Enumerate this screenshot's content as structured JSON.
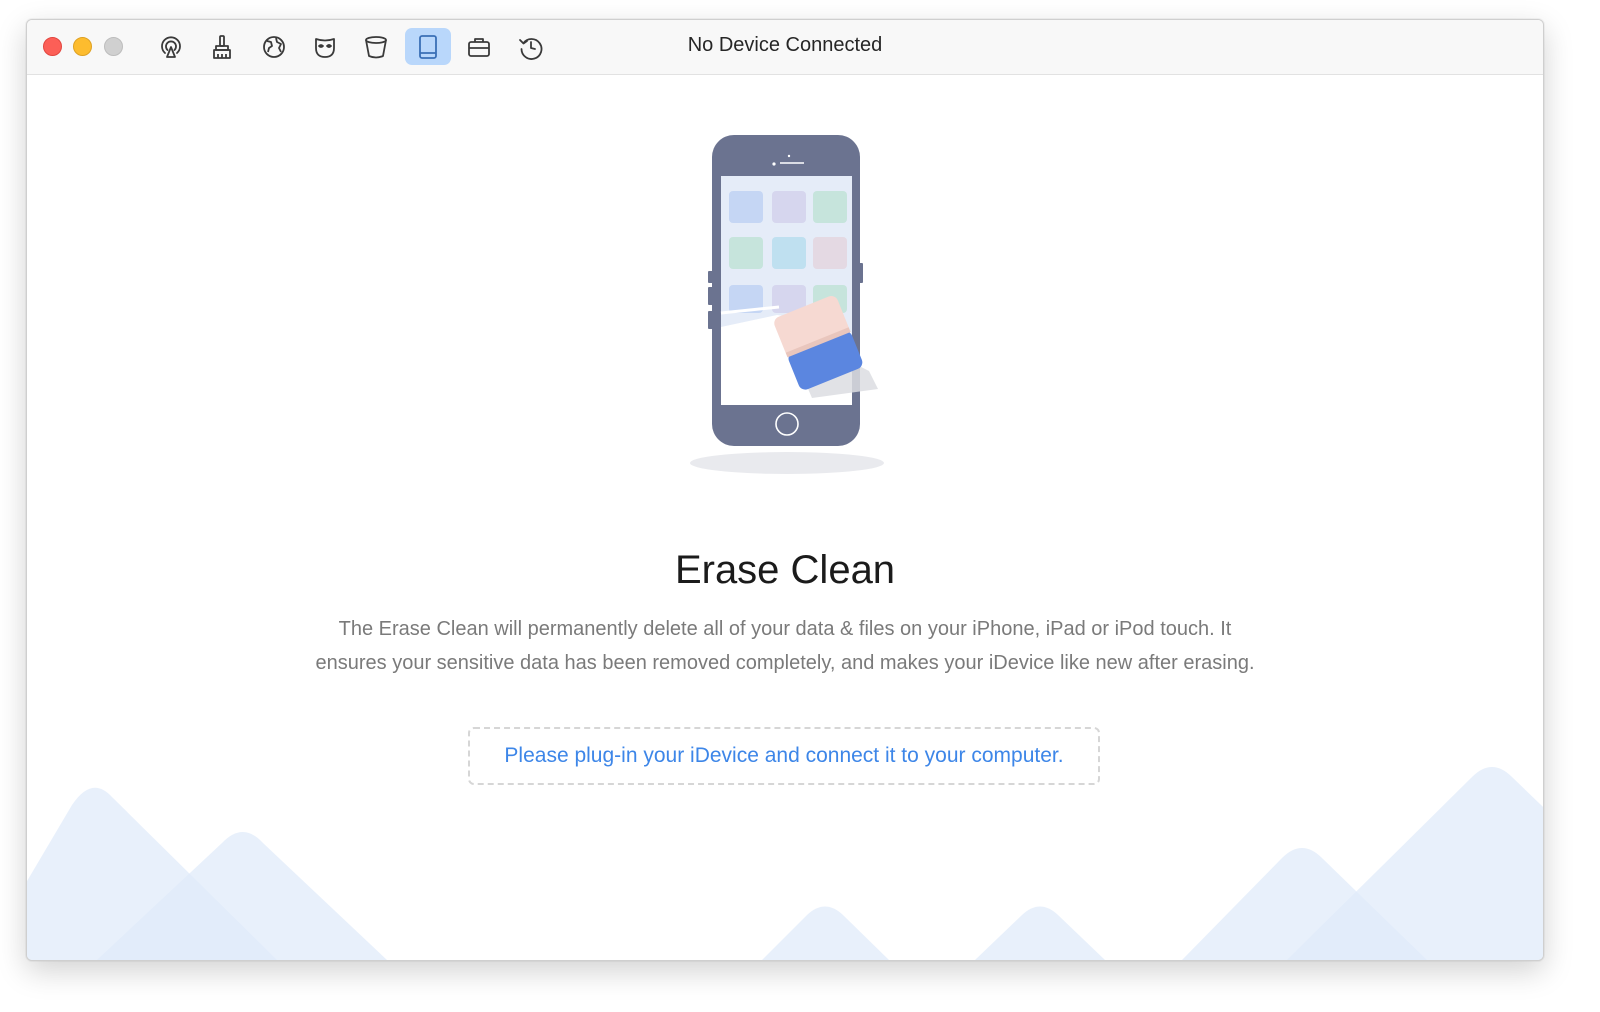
{
  "window": {
    "title": "No Device Connected"
  },
  "toolbar": {
    "items": [
      {
        "icon": "airplay-icon",
        "active": false
      },
      {
        "icon": "brush-icon",
        "active": false
      },
      {
        "icon": "globe-icon",
        "active": false
      },
      {
        "icon": "mask-icon",
        "active": false
      },
      {
        "icon": "bucket-icon",
        "active": false
      },
      {
        "icon": "tablet-icon",
        "active": true
      },
      {
        "icon": "briefcase-icon",
        "active": false
      },
      {
        "icon": "history-icon",
        "active": false
      }
    ]
  },
  "main": {
    "heading": "Erase Clean",
    "description_line1": "The Erase Clean will permanently delete all of your data & files on your iPhone, iPad or iPod touch. It",
    "description_line2": "ensures your sensitive data has been removed completely, and makes your iDevice like new after erasing.",
    "notice": "Please plug-in your iDevice and connect it to your computer."
  },
  "colors": {
    "accent": "#3d86e8",
    "active_tool": "#b9d7fb",
    "phone_body": "#6b7390",
    "eraser_top": "#f6d9d2",
    "eraser_bottom": "#5b86e0",
    "mountain": "#e7f0fb"
  }
}
